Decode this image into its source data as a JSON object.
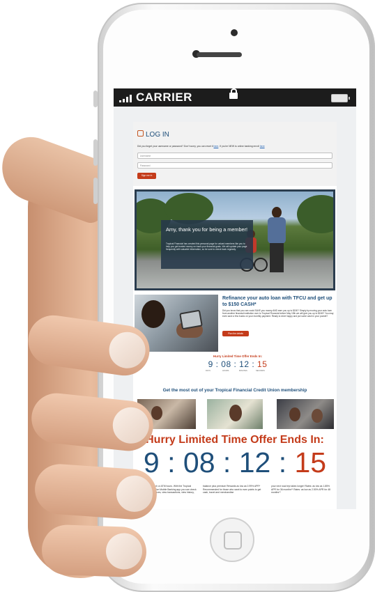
{
  "status_bar": {
    "carrier": "CARRIER"
  },
  "login": {
    "title": "LOG IN",
    "help_text_1": "Did you forget your username or password? Don't worry, you can reset it",
    "help_link_1": "here",
    "help_text_2": ". If you're NEW to online banking enroll",
    "help_link_2": "here",
    "username_placeholder": "Username",
    "password_placeholder": "Password",
    "signin_label": "Sign me in"
  },
  "hero": {
    "heading": "Amy, thank you for being a member!",
    "body": "Tropical Financial has created this personal page for valued members like you to help you get trusted money on track your financial goals. We will update your page frequently with valuable information, so be sure to check back regularly."
  },
  "promo": {
    "title": "Refinance your auto loan with TFCU and get up to $150 CASH*",
    "body": "Did you know that you can could SAVE you money AND earn you up to $150? Simply by moving your auto loan from another financial institution over to Tropical Financial before May 15th we will give you up to $150!* You may even save a few bucks on your monthly payment. Ready to drive happy and put some cash in your pocket?",
    "button": "Plan the details",
    "timer_title": "Hurry Limited Time Offer Ends In:",
    "timer": {
      "days": "9",
      "hours": "08",
      "minutes": "12",
      "seconds": "15"
    },
    "units": {
      "days": "DAYS",
      "hours": "HOURS",
      "minutes": "MINUTES",
      "seconds": "SECONDS"
    }
  },
  "membership": {
    "title": "Get the most out of your Tropical Financial Credit Union membership"
  },
  "big_timer": {
    "title": "Hurry Limited Time Offer Ends In:",
    "days": "9",
    "hours": "08",
    "minutes": "12",
    "seconds": "15"
  },
  "footer": {
    "col1": "longer take a branch or ATM hours. With the Tropical Financial Credit Union Mobile Banking app you can check your available balances, view transactions, view history, transfer funds",
    "col2": "balance plus premium Rewards as low as 0.99% APR* Recommended for those who want to earn points to get cash, travel and merchandise",
    "col3": "your next road trip takes longer! Rates: as low as 1.85% APR for 36 months** Rates: as low as 2.50% APR for 48 months**"
  },
  "colors": {
    "brand_blue": "#1f4f7a",
    "accent_red": "#c43b1a"
  }
}
